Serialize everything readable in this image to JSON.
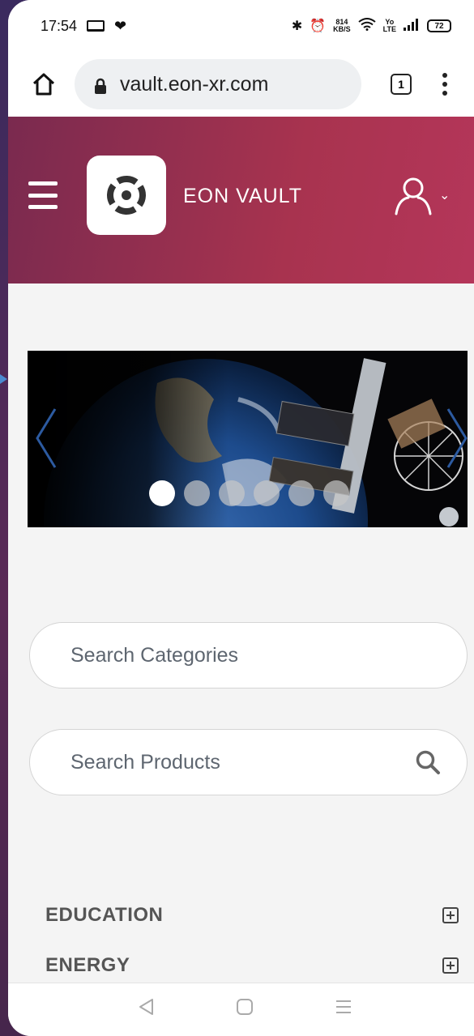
{
  "status_bar": {
    "time": "17:54",
    "speed_top": "814",
    "speed_bottom": "KB/S",
    "network_top": "Yo",
    "network_bottom": "LTE",
    "battery": "72"
  },
  "browser": {
    "url": "vault.eon-xr.com",
    "tab_count": "1"
  },
  "header": {
    "brand": "EON VAULT",
    "accent_color": "#a8334f"
  },
  "carousel": {
    "slide_count": 6,
    "active_index": 0
  },
  "search": {
    "categories_placeholder": "Search Categories",
    "products_placeholder": "Search Products"
  },
  "categories": [
    {
      "label": "EDUCATION"
    },
    {
      "label": "ENERGY"
    }
  ]
}
